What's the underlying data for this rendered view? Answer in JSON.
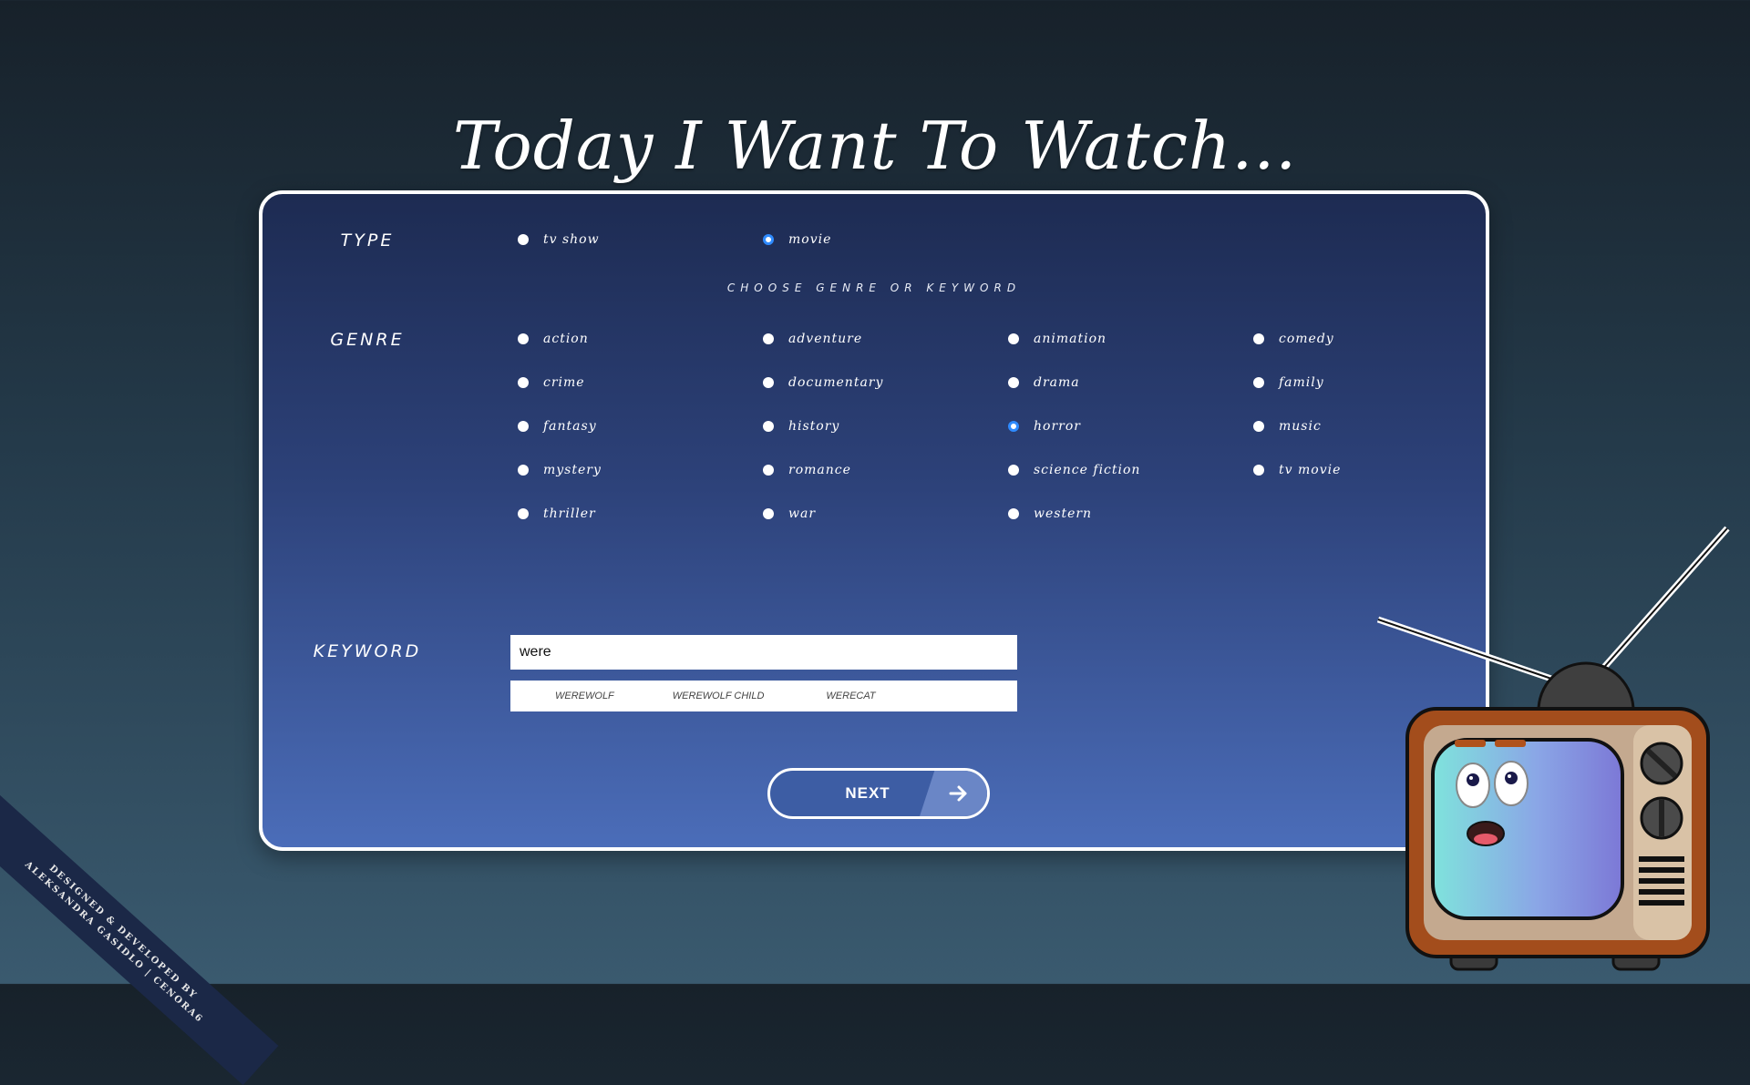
{
  "title": "Today I Want To Watch...",
  "type": {
    "label": "TYPE",
    "options": [
      {
        "label": "tv show",
        "checked": false
      },
      {
        "label": "movie",
        "checked": true
      }
    ]
  },
  "hint": "CHOOSE GENRE OR KEYWORD",
  "genre": {
    "label": "GENRE",
    "options": [
      {
        "label": "action",
        "checked": false
      },
      {
        "label": "adventure",
        "checked": false
      },
      {
        "label": "animation",
        "checked": false
      },
      {
        "label": "comedy",
        "checked": false
      },
      {
        "label": "crime",
        "checked": false
      },
      {
        "label": "documentary",
        "checked": false
      },
      {
        "label": "drama",
        "checked": false
      },
      {
        "label": "family",
        "checked": false
      },
      {
        "label": "fantasy",
        "checked": false
      },
      {
        "label": "history",
        "checked": false
      },
      {
        "label": "horror",
        "checked": true
      },
      {
        "label": "music",
        "checked": false
      },
      {
        "label": "mystery",
        "checked": false
      },
      {
        "label": "romance",
        "checked": false
      },
      {
        "label": "science fiction",
        "checked": false
      },
      {
        "label": "tv movie",
        "checked": false
      },
      {
        "label": "thriller",
        "checked": false
      },
      {
        "label": "war",
        "checked": false
      },
      {
        "label": "western",
        "checked": false
      }
    ]
  },
  "keyword": {
    "label": "KEYWORD",
    "value": "were",
    "suggestions": [
      "WEREWOLF",
      "WEREWOLF CHILD",
      "WERECAT"
    ]
  },
  "next": {
    "label": "NEXT",
    "icon": "arrow-right-icon"
  },
  "credit": {
    "line1": "DESIGNED & DEVELOPED BY",
    "line2": "ALEKSANDRA GASIDLO | CENORA6"
  },
  "colors": {
    "accent": "#2f8bff",
    "panel_top": "#1d2b52",
    "panel_bottom": "#4b6db9",
    "tv_body": "#a34d1c"
  }
}
